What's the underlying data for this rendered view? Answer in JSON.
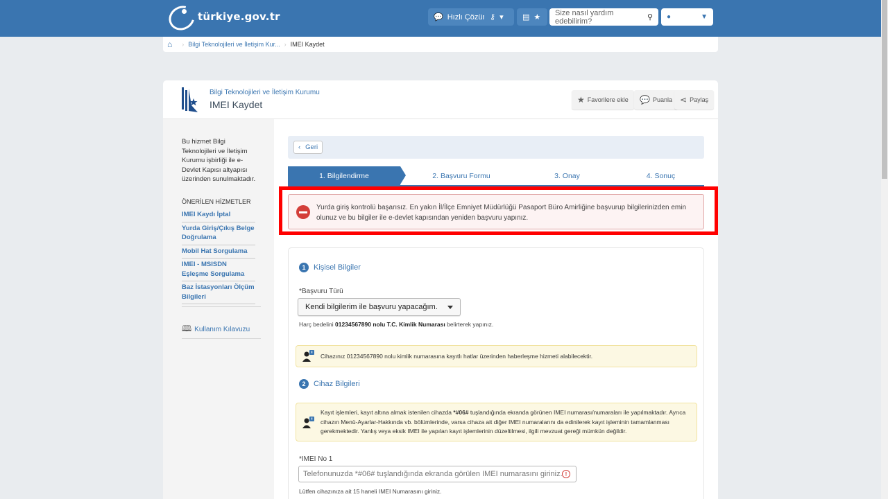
{
  "header": {
    "logo_text": "türkiye.gov.tr",
    "quick_solution_label": "Hızlı Çözüm",
    "search_placeholder": "Size nasıl yardım edebilirim?",
    "user_label": ""
  },
  "breadcrumb": {
    "items": [
      "Bilgi Teknolojileri ve İletişim Kur...",
      "IMEI Kaydet"
    ]
  },
  "page": {
    "institution": "Bilgi Teknolojileri ve İletişim Kurumu",
    "title": "IMEI Kaydet",
    "actions": {
      "favorite": "Favorilere ekle",
      "rate": "Puanla",
      "share": "Paylaş"
    }
  },
  "sidebar": {
    "note": "Bu hizmet Bilgi Teknolojileri ve İletişim Kurumu işbirliği ile e-Devlet Kapısı altyapısı üzerinden sunulmaktadır.",
    "recommended_heading": "ÖNERİLEN HİZMETLER",
    "services": [
      "IMEI Kaydı İptal",
      "Yurda Giriş/Çıkış Belge Doğrulama",
      "Mobil Hat Sorgulama",
      "IMEI - MSISDN Eşleşme Sorgulama",
      "Baz İstasyonları Ölçüm Bilgileri"
    ],
    "guide": "Kullanım Kılavuzu"
  },
  "content": {
    "back_label": "Geri",
    "steps": [
      "1. Bilgilendirme",
      "2. Başvuru Formu",
      "3. Onay",
      "4. Sonuç"
    ],
    "active_step": 1,
    "error_message": "Yurda giriş kontrolü başarısız. En yakın İl/İlçe Emniyet Müdürlüğü Pasaport Büro Amirliğine başvurup bilgilerinizden emin olunuz ve bu bilgiler ile e-devlet kapısından yeniden başvuru yapınız.",
    "section1": {
      "number": "1",
      "title": "Kişisel Bilgiler",
      "field_label": "*Başvuru Türü",
      "selected_value": "Kendi bilgilerim ile başvuru yapacağım.",
      "hint_prefix": "Harç bedelini ",
      "hint_bold": "01234567890 nolu T.C. Kimlik Numarası",
      "hint_suffix": " belirterek yapınız.",
      "info": "Cihazınız 01234567890 nolu kimlik numarasına kayıtlı hatlar üzerinden haberleşme hizmeti alabilecektir."
    },
    "section2": {
      "number": "2",
      "title": "Cihaz Bilgileri",
      "info_prefix": "Kayıt işlemleri, kayıt altına almak istenilen cihazda ",
      "info_bold": "*#06#",
      "info_suffix": " tuşlandığında ekranda görünen IMEI numarası/numaraları ile yapılmaktadır. Ayrıca cihazın Menü-Ayarlar-Hakkında vb. bölümlerinde, varsa cihaza ait diğer IMEI numaralarını da edinilerek kayıt işleminin tamamlanması gerekmektedir. Yanlış veya eksik IMEI ile yapılan kayıt işlemlerinin düzeltilmesi, ilgili mevzuat gereği mümkün değildir.",
      "imei_label": "*IMEI No 1",
      "imei_placeholder": "Telefonunuzda *#06# tuşlandığında ekranda görülen IMEI numarasını giriniz.",
      "imei_hint": "Lütfen cihazınıza ait 15 haneli IMEI Numarasını giriniz."
    }
  },
  "colors": {
    "primary": "#3a75b0",
    "error": "#d43f3a",
    "highlight": "#ff0000",
    "warning_bg": "#fcf8e3"
  }
}
